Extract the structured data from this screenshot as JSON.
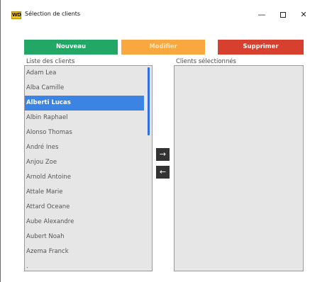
{
  "window": {
    "icon_text": "WD",
    "title": "Sélection de clients",
    "controls": {
      "minimize": "—",
      "close": "✕"
    }
  },
  "actions": {
    "new_label": "Nouveau",
    "edit_label": "Modifier",
    "delete_label": "Supprimer"
  },
  "left_list": {
    "label": "Liste des clients",
    "items": [
      "Adam Lea",
      "Alba Camille",
      "Alberti Lucas",
      "Albin Raphael",
      "Alonso Thomas",
      "André Ines",
      "Anjou Zoe",
      "Arnold Antoine",
      "Attale Marie",
      "Attard Oceane",
      "Aube Alexandre",
      "Aubert Noah",
      "Azema Franck",
      "."
    ],
    "selected": "Alberti Lucas"
  },
  "transfer": {
    "add_label": "→",
    "remove_label": "←"
  },
  "right_list": {
    "label": "Clients sélectionnés",
    "items": []
  },
  "colors": {
    "new": "#22a766",
    "edit": "#f9a73f",
    "delete": "#d7402f",
    "selection": "#3c84e4"
  }
}
